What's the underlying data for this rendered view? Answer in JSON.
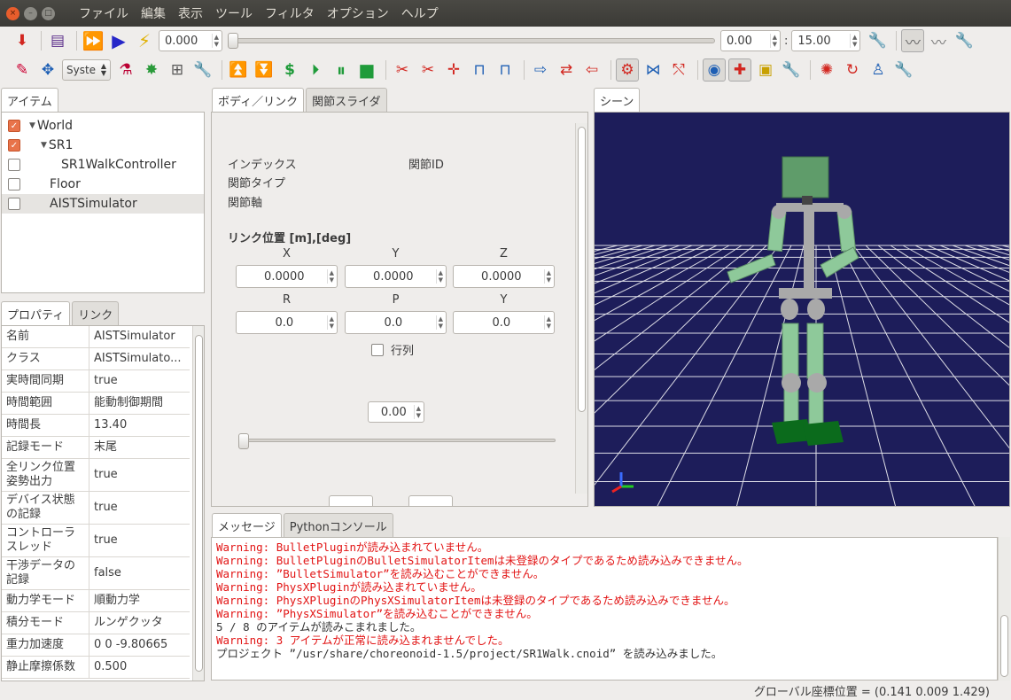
{
  "window": {
    "menu": [
      "ファイル",
      "編集",
      "表示",
      "ツール",
      "フィルタ",
      "オプション",
      "ヘルプ"
    ],
    "controls": [
      "×",
      "–",
      "□"
    ]
  },
  "toolbar1": {
    "time_value": "0.000",
    "range_start": "0.00",
    "range_separator": ":",
    "range_end": "15.00",
    "time_slider_fraction": 0.0
  },
  "toolbar2": {
    "combo_value": "Syste"
  },
  "items_panel": {
    "tab": "アイテム",
    "tree": [
      {
        "label": "World",
        "checked": true,
        "expanded": true,
        "depth": 0
      },
      {
        "label": "SR1",
        "checked": true,
        "expanded": true,
        "depth": 1
      },
      {
        "label": "SR1WalkController",
        "checked": false,
        "expanded": false,
        "depth": 2
      },
      {
        "label": "Floor",
        "checked": false,
        "expanded": false,
        "depth": 1
      },
      {
        "label": "AISTSimulator",
        "checked": false,
        "expanded": false,
        "depth": 1,
        "selected": true
      }
    ]
  },
  "properties_panel": {
    "tabs": [
      "プロパティ",
      "リンク"
    ],
    "rows": [
      {
        "name": "名前",
        "value": "AISTSimulator"
      },
      {
        "name": "クラス",
        "value": "AISTSimulato..."
      },
      {
        "name": "実時間同期",
        "value": "true"
      },
      {
        "name": "時間範囲",
        "value": "能動制御期間"
      },
      {
        "name": "時間長",
        "value": "13.40"
      },
      {
        "name": "記録モード",
        "value": "末尾"
      },
      {
        "name": "全リンク位置姿勢出力",
        "value": "true"
      },
      {
        "name": "デバイス状態の記録",
        "value": "true"
      },
      {
        "name": "コントローラスレッド",
        "value": "true"
      },
      {
        "name": "干渉データの記録",
        "value": "false"
      },
      {
        "name": "動力学モード",
        "value": "順動力学"
      },
      {
        "name": "積分モード",
        "value": "ルンゲクッタ"
      },
      {
        "name": "重力加速度",
        "value": "0  0  -9.80665"
      },
      {
        "name": "静止摩擦係数",
        "value": "0.500"
      }
    ]
  },
  "body_link_panel": {
    "tabs": [
      "ボディ／リンク",
      "関節スライダ"
    ],
    "index_label": "インデックス",
    "joint_id_label": "関節ID",
    "joint_type_label": "関節タイプ",
    "joint_axis_label": "関節軸",
    "link_position_label": "リンク位置 [m],[deg]",
    "position_headers": [
      "X",
      "Y",
      "Z"
    ],
    "position_values": [
      "0.0000",
      "0.0000",
      "0.0000"
    ],
    "rotation_headers": [
      "R",
      "P",
      "Y"
    ],
    "rotation_values": [
      "0.0",
      "0.0",
      "0.0"
    ],
    "matrix_label": "行列",
    "joint_value": "0.00",
    "joint_slider_fraction": 0.0
  },
  "scene_panel": {
    "tab": "シーン"
  },
  "messages_panel": {
    "tabs": [
      "メッセージ",
      "Pythonコンソール"
    ],
    "lines": [
      {
        "text": "Warning: BulletPluginが読み込まれていません。",
        "level": "warn"
      },
      {
        "text": "Warning: BulletPluginのBulletSimulatorItemは未登録のタイプであるため読み込みできません。",
        "level": "warn"
      },
      {
        "text": "Warning: ”BulletSimulator”を読み込むことができません。",
        "level": "warn"
      },
      {
        "text": "Warning: PhysXPluginが読み込まれていません。",
        "level": "warn"
      },
      {
        "text": "Warning: PhysXPluginのPhysXSimulatorItemは未登録のタイプであるため読み込みできません。",
        "level": "warn"
      },
      {
        "text": "Warning: ”PhysXSimulator”を読み込むことができません。",
        "level": "warn"
      },
      {
        "text": "5 / 8 のアイテムが読みこまれました。",
        "level": "info"
      },
      {
        "text": "Warning: 3 アイテムが正常に読み込まれませんでした。",
        "level": "warn"
      },
      {
        "text": "プロジェクト ”/usr/share/choreonoid-1.5/project/SR1Walk.cnoid” を読み込みました。",
        "level": "info"
      }
    ]
  },
  "statusbar": {
    "text": "グローバル座標位置 = (0.141 0.009 1.429)"
  },
  "colors": {
    "warning": "#e21414",
    "scene_background": "#1d1d5a",
    "robot_body": "#8ec99a",
    "robot_joint": "#a9a9a9",
    "checkbox_checked": "#e8734a"
  }
}
